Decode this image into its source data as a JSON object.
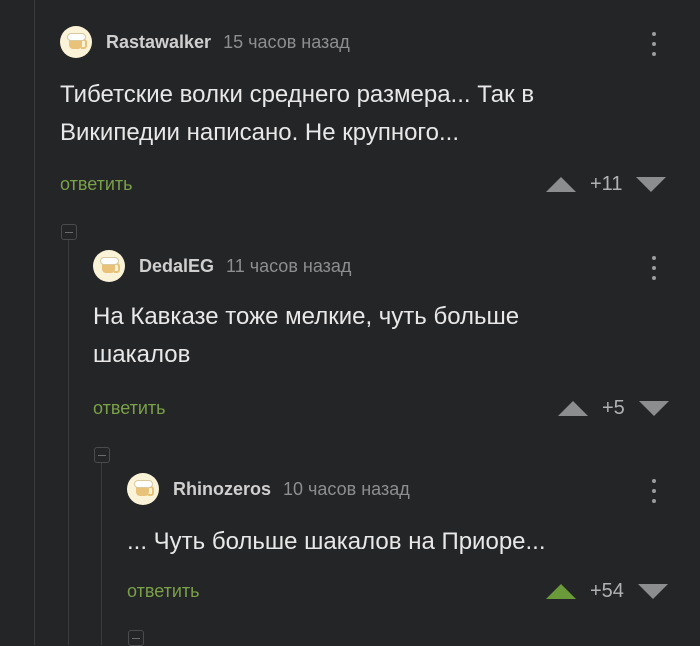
{
  "comments": [
    {
      "username": "Rastawalker",
      "time": "15 часов назад",
      "text_lines": [
        "Тибетские волки среднего размера... Так в",
        "Википедии написано. Не крупного..."
      ],
      "reply_label": "ответить",
      "score": "+11",
      "upvoted": false
    },
    {
      "username": "DedalEG",
      "time": "11 часов назад",
      "text_lines": [
        "На Кавказе тоже мелкие, чуть больше",
        "шакалов"
      ],
      "reply_label": "ответить",
      "score": "+5",
      "upvoted": false
    },
    {
      "username": "Rhinozeros",
      "time": "10 часов назад",
      "text_lines": [
        "... Чуть больше шакалов на Приоре..."
      ],
      "reply_label": "ответить",
      "score": "+54",
      "upvoted": true
    }
  ],
  "colors": {
    "background": "#242527",
    "reply_link": "#7aa048",
    "upvote_active": "#6a9a3a",
    "vote_inactive": "#8c8d8f"
  }
}
